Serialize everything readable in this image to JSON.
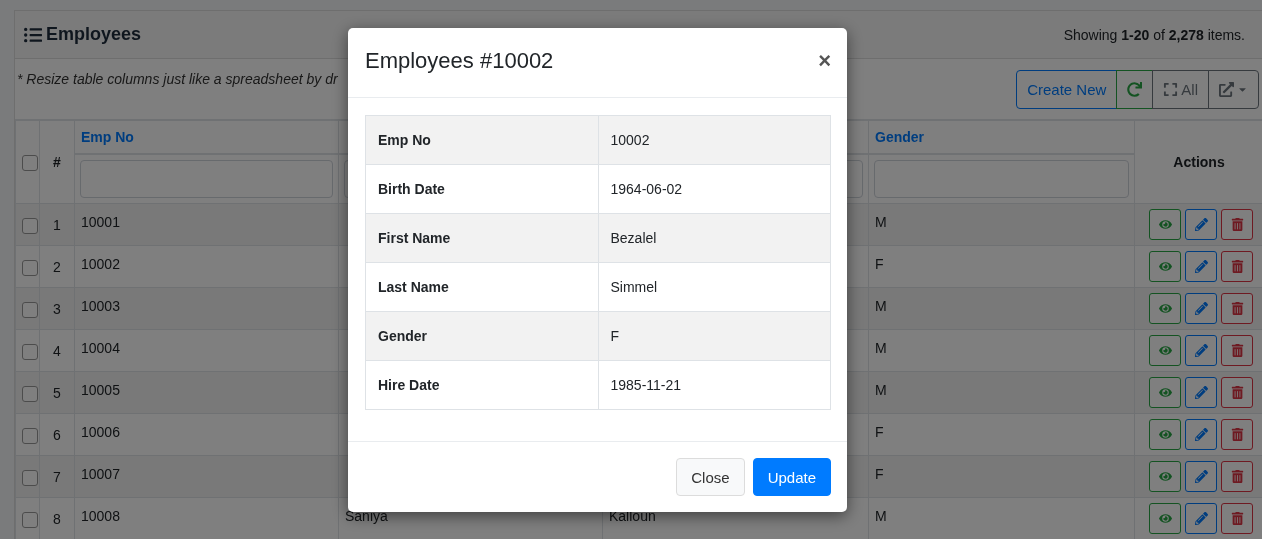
{
  "header": {
    "title": "Employees",
    "summary": "Showing **1-20** of **2,278** items."
  },
  "note": "* Resize table columns just like a spreadsheet by dr",
  "toolbar": [
    {
      "kind": "primary",
      "label": "Create New"
    },
    {
      "kind": "refresh"
    },
    {
      "kind": "expand",
      "label": "All"
    },
    {
      "kind": "export"
    }
  ],
  "table": {
    "select_all": {
      "checked": false
    },
    "columns": [
      {
        "kind": "index",
        "label": "#"
      },
      {
        "kind": "field",
        "label": "Emp No"
      },
      {
        "kind": "field"
      },
      {
        "kind": "field"
      },
      {
        "kind": "field",
        "label": "Gender"
      },
      {
        "kind": "actions",
        "label": "Actions"
      }
    ],
    "rows": [
      {
        "checked": false,
        "index": "1",
        "emp_no": "10001",
        "gender": "M"
      },
      {
        "checked": false,
        "index": "2",
        "emp_no": "10002",
        "gender": "F"
      },
      {
        "checked": false,
        "index": "3",
        "emp_no": "10003",
        "gender": "M"
      },
      {
        "checked": false,
        "index": "4",
        "emp_no": "10004",
        "gender": "M"
      },
      {
        "checked": false,
        "index": "5",
        "emp_no": "10005",
        "gender": "M"
      },
      {
        "checked": false,
        "index": "6",
        "emp_no": "10006",
        "gender": "F"
      },
      {
        "checked": false,
        "index": "7",
        "emp_no": "10007",
        "gender": "F"
      },
      {
        "checked": false,
        "index": "8",
        "emp_no": "10008",
        "column_3": "Saniya",
        "column_4": "Kalloun",
        "gender": "M"
      }
    ]
  },
  "modal": {
    "title": "Employees #10002",
    "close": "×",
    "fields": [
      {
        "label": "Emp No",
        "value": "10002"
      },
      {
        "label": "Birth Date",
        "value": "1964-06-02"
      },
      {
        "label": "First Name",
        "value": "Bezalel"
      },
      {
        "label": "Last Name",
        "value": "Simmel"
      },
      {
        "label": "Gender",
        "value": "F"
      },
      {
        "label": "Hire Date",
        "value": "1985-11-21"
      }
    ],
    "buttons": [
      {
        "kind": "secondary",
        "label": "Close"
      },
      {
        "kind": "primary",
        "label": "Update"
      }
    ]
  }
}
